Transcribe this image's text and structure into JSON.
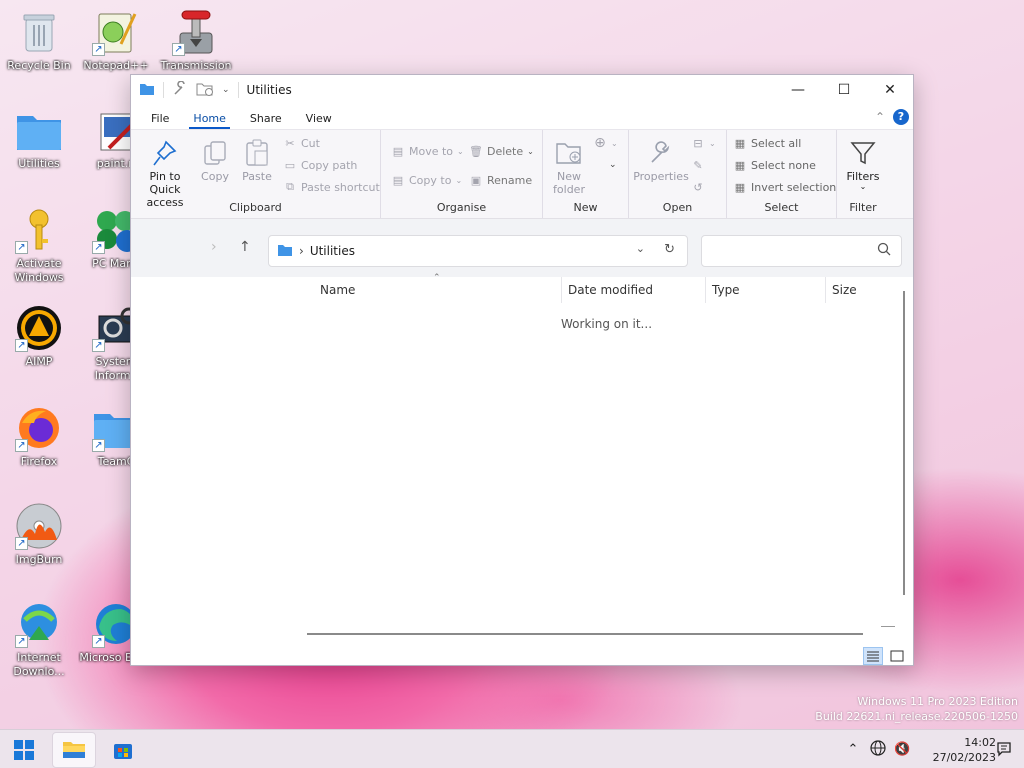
{
  "desktop": {
    "icons": [
      {
        "label": "Recycle Bin"
      },
      {
        "label": "Notepad++"
      },
      {
        "label": "Transmission"
      },
      {
        "label": "Utilities"
      },
      {
        "label": "paint.n"
      },
      {
        "label": "Activate Windows"
      },
      {
        "label": "PC Mana"
      },
      {
        "label": "AIMP"
      },
      {
        "label": "System Informa"
      },
      {
        "label": "Firefox"
      },
      {
        "label": "TeamC"
      },
      {
        "label": "ImgBurn"
      },
      {
        "label": "Internet Downlo..."
      },
      {
        "label": "Microso Edge"
      }
    ]
  },
  "window": {
    "title": "Utilities",
    "tabs": [
      "File",
      "Home",
      "Share",
      "View"
    ],
    "active_tab": "Home",
    "ribbon": {
      "clipboard": {
        "name": "Clipboard",
        "pin": "Pin to Quick access",
        "copy": "Copy",
        "paste": "Paste",
        "cut": "Cut",
        "copy_path": "Copy path",
        "paste_shortcut": "Paste shortcut"
      },
      "organise": {
        "name": "Organise",
        "move_to": "Move to",
        "copy_to": "Copy to",
        "delete": "Delete",
        "rename": "Rename"
      },
      "new": {
        "name": "New",
        "new_folder": "New folder"
      },
      "open": {
        "name": "Open",
        "properties": "Properties"
      },
      "select": {
        "name": "Select",
        "select_all": "Select all",
        "select_none": "Select none",
        "invert": "Invert selection"
      },
      "filter": {
        "name": "Filter",
        "filters": "Filters"
      }
    },
    "address": {
      "path": "Utilities"
    },
    "search": {
      "placeholder": ""
    },
    "columns": [
      "Name",
      "Date modified",
      "Type",
      "Size"
    ],
    "status": "Working on it..."
  },
  "watermark": {
    "line1": "Windows 11 Pro 2023 Edition",
    "line2": "Build 22621.ni_release.220506-1250"
  },
  "taskbar": {
    "time": "14:02",
    "date": "27/02/2023"
  },
  "colors": {
    "accent": "#0a58c9",
    "folder": "#4aa3ee"
  }
}
